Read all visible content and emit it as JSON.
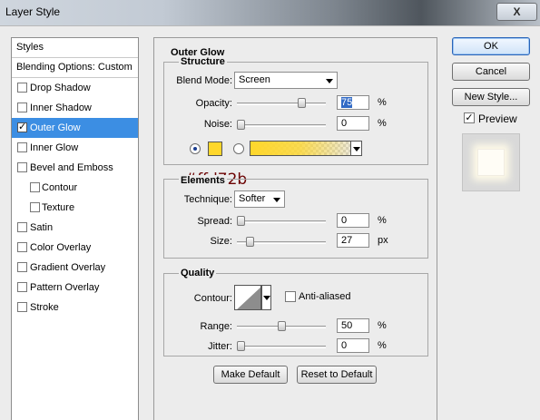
{
  "window": {
    "title": "Layer Style",
    "close_label": "X"
  },
  "styles_list": {
    "header": "Styles",
    "blending": "Blending Options: Custom",
    "items": [
      {
        "label": "Drop Shadow",
        "checked": false,
        "sub": false
      },
      {
        "label": "Inner Shadow",
        "checked": false,
        "sub": false
      },
      {
        "label": "Outer Glow",
        "checked": true,
        "sub": false,
        "selected": true
      },
      {
        "label": "Inner Glow",
        "checked": false,
        "sub": false
      },
      {
        "label": "Bevel and Emboss",
        "checked": false,
        "sub": false
      },
      {
        "label": "Contour",
        "checked": false,
        "sub": true
      },
      {
        "label": "Texture",
        "checked": false,
        "sub": true
      },
      {
        "label": "Satin",
        "checked": false,
        "sub": false
      },
      {
        "label": "Color Overlay",
        "checked": false,
        "sub": false
      },
      {
        "label": "Gradient Overlay",
        "checked": false,
        "sub": false
      },
      {
        "label": "Pattern Overlay",
        "checked": false,
        "sub": false
      },
      {
        "label": "Stroke",
        "checked": false,
        "sub": false
      }
    ],
    "check_glyph": "✓"
  },
  "outer_glow": {
    "title": "Outer Glow",
    "structure": {
      "title": "Structure",
      "blend_mode_label": "Blend Mode:",
      "blend_mode": "Screen",
      "opacity_label": "Opacity:",
      "opacity": "75",
      "opacity_unit": "%",
      "opacity_level": 0.75,
      "noise_label": "Noise:",
      "noise": "0",
      "noise_unit": "%",
      "noise_level": 0,
      "glow_color": "#ffd72b",
      "glow_color_label": "#ffd72b"
    },
    "elements": {
      "title": "Elements",
      "technique_label": "Technique:",
      "technique": "Softer",
      "spread_label": "Spread:",
      "spread": "0",
      "spread_unit": "%",
      "spread_level": 0,
      "size_label": "Size:",
      "size": "27",
      "size_unit": "px",
      "size_level": 0.11
    },
    "quality": {
      "title": "Quality",
      "contour_label": "Contour:",
      "anti_aliased_label": "Anti-aliased",
      "anti_aliased": false,
      "range_label": "Range:",
      "range": "50",
      "range_unit": "%",
      "range_level": 0.5,
      "jitter_label": "Jitter:",
      "jitter": "0",
      "jitter_unit": "%",
      "jitter_level": 0
    },
    "make_default": "Make Default",
    "reset_default": "Reset to Default"
  },
  "actions": {
    "ok": "OK",
    "cancel": "Cancel",
    "new_style": "New Style...",
    "preview_label": "Preview",
    "preview_checked": true
  },
  "colors": {
    "selection": "#3c8ee3",
    "glow": "#ffd72b"
  }
}
